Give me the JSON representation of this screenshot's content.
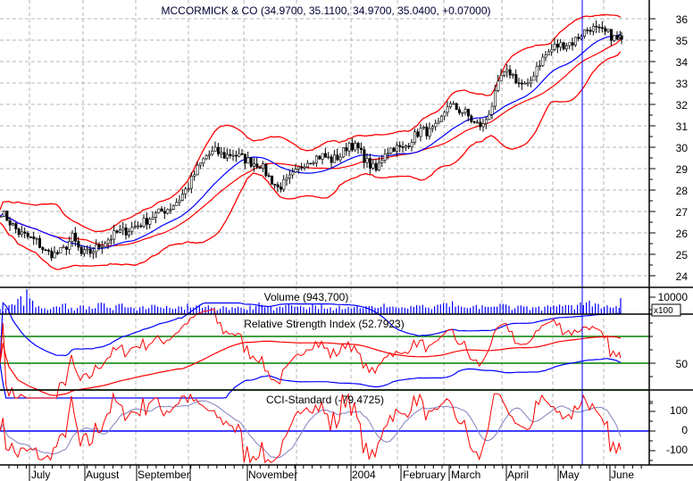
{
  "chart_data": [
    {
      "type": "candlestick",
      "title": "MCCORMICK & CO (34.9700, 35.1100, 34.9700, 35.0400, +0.07000)",
      "ylim": [
        24,
        36
      ],
      "yticks": [
        "24",
        "25",
        "26",
        "27",
        "28",
        "29",
        "30",
        "31",
        "32",
        "33",
        "34",
        "35",
        "36"
      ],
      "overlays": [
        "Bollinger upper band",
        "Bollinger lower band",
        "moving average (blue)",
        "moving average (red)"
      ],
      "close_approx": [
        27.0,
        26.5,
        26.0,
        25.8,
        25.6,
        25.1,
        25.0,
        25.2,
        25.8,
        25.0,
        25.1,
        25.4,
        25.7,
        26.0,
        26.1,
        26.3,
        26.5,
        26.8,
        27.0,
        27.2,
        27.6,
        28.2,
        29.0,
        29.6,
        29.8,
        29.6,
        29.7,
        29.5,
        29.3,
        29.2,
        28.6,
        28.1,
        28.4,
        28.8,
        29.3,
        29.5,
        29.6,
        29.4,
        29.6,
        30.2,
        29.9,
        29.3,
        28.9,
        29.8,
        30.0,
        29.9,
        30.4,
        30.8,
        30.7,
        31.0,
        32.0,
        31.8,
        31.6,
        31.1,
        31.0,
        32.0,
        33.3,
        33.5,
        33.0,
        32.8,
        33.8,
        34.3,
        34.7,
        34.8,
        34.9,
        35.3,
        35.6,
        35.4,
        35.3,
        35.0,
        35.04
      ]
    },
    {
      "type": "bar",
      "title": "Volume (943,700)",
      "unit_label": "x100",
      "yticks": [
        "10000"
      ],
      "values": [
        3000,
        5200,
        9000,
        15000,
        4000,
        3500,
        4200,
        6000,
        3800,
        5000,
        4500,
        6500,
        3900,
        5200,
        4100,
        3600,
        4800,
        5500,
        4000,
        3700,
        4600,
        6200,
        5100,
        4300,
        3900,
        4700,
        4100,
        3800,
        5000,
        6800,
        4200,
        3900,
        5300,
        4400,
        4100,
        6000,
        5600,
        4000,
        4900,
        4300,
        5200,
        4700,
        3800,
        6200,
        4500,
        4100,
        4800,
        5000,
        3900,
        5600,
        6500,
        4400,
        4000,
        4800,
        5200,
        4300,
        6100,
        4900,
        5000,
        4600,
        4000,
        4400,
        5100,
        4700,
        5300,
        7000,
        8000,
        6000,
        5200,
        4800,
        9500
      ]
    },
    {
      "type": "line",
      "title": "Relative Strength Index (52.7923)",
      "yticks": [
        "50"
      ],
      "reference_levels": [
        30,
        50,
        70
      ],
      "ylim": [
        20,
        100
      ]
    },
    {
      "type": "line",
      "title": "CCI-Standard (-79.4725)",
      "yticks": [
        "100",
        "0",
        "-100"
      ],
      "reference_levels": [
        0
      ],
      "ylim": [
        -170,
        200
      ]
    }
  ],
  "x_axis": {
    "labels": [
      "July",
      "August",
      "September",
      "November",
      "2004",
      "February",
      "March",
      "April",
      "May",
      "June"
    ]
  },
  "colors": {
    "candle": "#000000",
    "band": "#ff0000",
    "ma": "#0000ff",
    "rsi": "#ff0000",
    "rsi_ref": "#008000",
    "cci_signal": "#8080c0",
    "cursor": "#0000ff",
    "grid": "#b4b4b4"
  }
}
